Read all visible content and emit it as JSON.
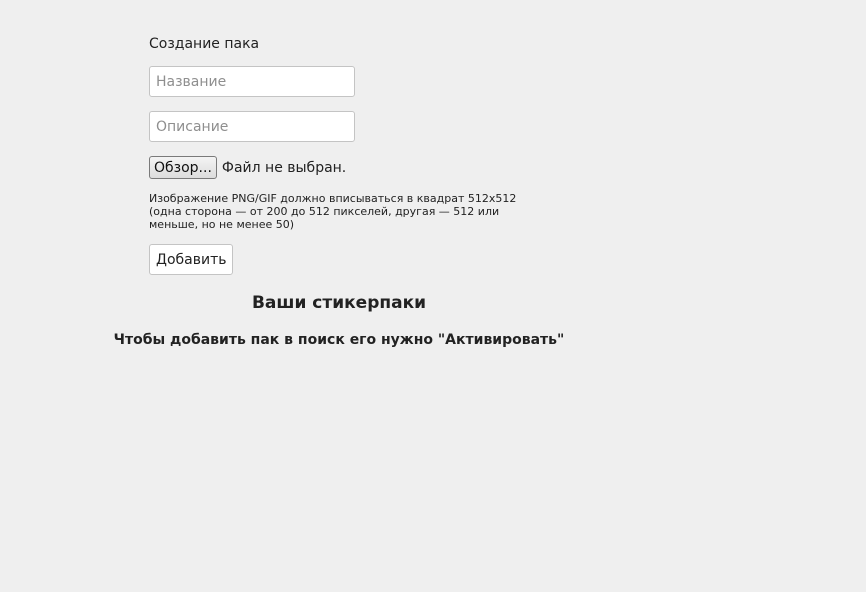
{
  "form": {
    "title": "Создание пака",
    "name_placeholder": "Название",
    "description_placeholder": "Описание",
    "file_button_label": "Обзор...",
    "file_status": "Файл не выбран.",
    "hint_line1": "Изображение PNG/GIF должно вписываться в квадрат 512x512",
    "hint_line2": "(одна сторона — от 200 до 512 пикселей, другая — 512 или",
    "hint_line3": "меньше, но не менее 50)",
    "add_button_label": "Добавить"
  },
  "packs": {
    "heading": "Ваши стикерпаки",
    "activate_note": "Чтобы добавить пак в поиск его нужно \"Активировать\""
  }
}
